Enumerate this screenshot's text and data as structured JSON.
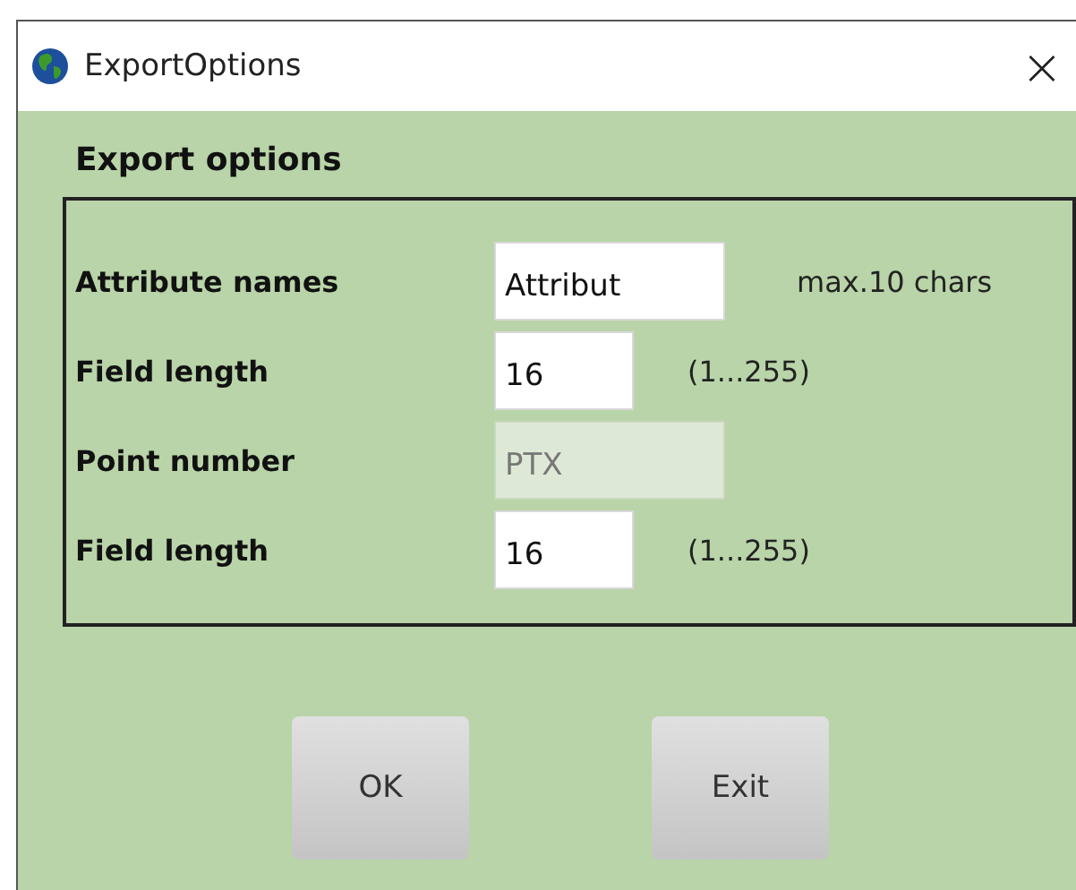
{
  "window": {
    "title": "ExportOptions",
    "close": "×"
  },
  "heading": "Export options",
  "fields": [
    {
      "label": "Attribute names",
      "value": "Attribut",
      "disabled": false,
      "wide": true,
      "hint": "max.10 chars"
    },
    {
      "label": "Field length",
      "value": "16",
      "disabled": false,
      "wide": false,
      "hint": "(1...255)"
    },
    {
      "label": "Point number",
      "value": "PTX",
      "disabled": true,
      "wide": true
    },
    {
      "label": "Field length",
      "value": "16",
      "disabled": false,
      "wide": false,
      "hint": "(1...255)"
    }
  ],
  "buttons": [
    "OK",
    "Exit"
  ]
}
